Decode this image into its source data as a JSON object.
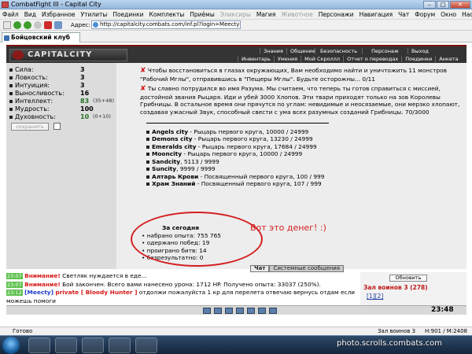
{
  "window": {
    "title": "CombatFight III - Capital City"
  },
  "menu": [
    "Файл",
    "Вид",
    "Избранное",
    "Утилиты",
    "Поединки",
    "Комплекты",
    "Приёмы",
    "Эликсиры",
    "Магия",
    "Животное",
    "Персонажи",
    "Навигация",
    "Чат",
    "Форум",
    "Окно",
    "Настройки"
  ],
  "menu_dimmed": [
    7,
    9
  ],
  "address": {
    "label": "Адрес:",
    "url": "http://capitalcity.combats.com/inf.pl?login=Meecty"
  },
  "tab": {
    "label": "Бойцовский клуб"
  },
  "game": {
    "logo": "CAPITALCITY",
    "nav_top": [
      "Знания",
      "Общение",
      "Безопасность",
      "Персонаж",
      "Выход"
    ],
    "nav_bottom": [
      "Инвентарь",
      "Умения",
      "Мой Скроллл",
      "Отчет о переводах",
      "Поединки",
      "Анкета"
    ]
  },
  "stats": [
    {
      "label": "Сила:",
      "value": "3",
      "green": false,
      "extra": ""
    },
    {
      "label": "Ловкость:",
      "value": "3",
      "green": false,
      "extra": ""
    },
    {
      "label": "Интуиция:",
      "value": "3",
      "green": false,
      "extra": ""
    },
    {
      "label": "Выносливость:",
      "value": "16",
      "green": false,
      "extra": ""
    },
    {
      "label": "Интеллект:",
      "value": "83",
      "green": true,
      "extra": "(35+48)"
    },
    {
      "label": "Мудрость:",
      "value": "100",
      "green": false,
      "extra": ""
    },
    {
      "label": "Духовность:",
      "value": "10",
      "green": true,
      "extra": "(0+10)"
    }
  ],
  "save_button": "сохранить",
  "quests": [
    {
      "text": "Чтобы восстановиться в глазах окружающих, Вам необходимо найти и уничтожить 11 монстров \"Рабочий Мглы\", отправившись в \"Пещеры Мглы\". Будьте осторожны... 0/11"
    },
    {
      "text": "Ты славно потрудился во имя Разума. Мы считаем, что теперь ты готов справиться с миссией, достойной звания Рыцаря. Иди и убей 3000 Хлопов. Эти твари приходят только на зов Королевы Грибницы. В остальное время они прячутся по углам: невидимые и неосязаемые, они мерзко хлопают, создавая ужасный Звук, способный свести с ума всех разумных созданий Грибницы. 70/3000"
    }
  ],
  "cities": [
    {
      "name": "Angels city",
      "rest": " - Рыцарь первого круга, 10000 / 24999"
    },
    {
      "name": "Demons city",
      "rest": " - Рыцарь первого круга, 13230 / 24999"
    },
    {
      "name": "Emeralds city",
      "rest": " - Рыцарь первого круга, 17684 / 24999"
    },
    {
      "name": "Mooncity",
      "rest": " - Рыцарь первого круга, 10000 / 24999"
    },
    {
      "name": "Sandcity",
      "rest": ", 5113 / 9999"
    },
    {
      "name": "Suncity",
      "rest": ", 9999 / 9999"
    },
    {
      "name": "Алтарь Крови",
      "rest": " - Посвященный первого круга, 100 / 999"
    },
    {
      "name": "Храм Знаний",
      "rest": " - Посвященный первого круга, 107 / 999"
    }
  ],
  "today": {
    "heading": "За сегодня",
    "items": [
      "набрано опыта: 755 765",
      "одержано побед: 19",
      "проиграно битв: 14",
      "безрезультатно: 0"
    ]
  },
  "annotation": "Вот это денег! :)",
  "chat_tabs": [
    "Чат",
    "Системные сообщения"
  ],
  "chat": [
    {
      "time": "23:07",
      "who": "Внимание!",
      "text": " Светляк нуждается в еде..."
    },
    {
      "time": "23:07",
      "who": "Внимание!",
      "text": " Бой закончен. Всего вами нанесено урона: 1712 HP. Получено опыта: 33037 (250%)."
    },
    {
      "time": "23:12",
      "who": "[Meecty]",
      "private": "private [ Bloody Hunter ]",
      "text": " отдолжи пожалуйста 1 кр для перелета отвечаю вернусь отдам если можешь помоги"
    }
  ],
  "side": {
    "refresh": "Обновить",
    "room": "Зал воинов 3 (278)",
    "pages": "[1][2]"
  },
  "clock": "23:48",
  "status": {
    "left": "Готово",
    "room": "Зал воинов 3",
    "hp": "H:901 / M:2408"
  },
  "watermark": "photo.scrolls.combats.com"
}
